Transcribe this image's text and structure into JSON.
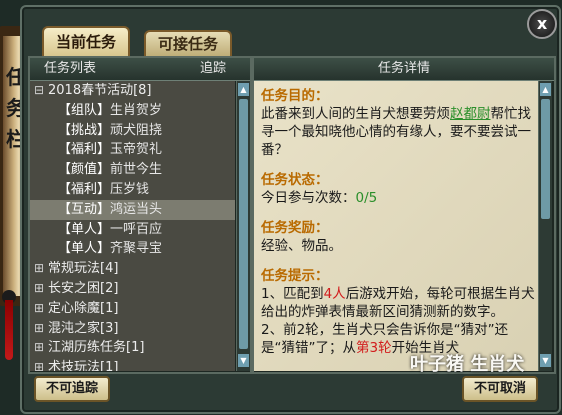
{
  "side_title": [
    "任",
    "务",
    "栏"
  ],
  "close_label": "x",
  "tabs": {
    "current": "当前任务",
    "available": "可接任务"
  },
  "left_panel": {
    "header_left": "任务列表",
    "header_right": "追踪"
  },
  "right_panel": {
    "header": "任务详情"
  },
  "quest_list": [
    {
      "type": "group",
      "expander": "⊟",
      "label": "2018春节活动[8]"
    },
    {
      "type": "item",
      "tag": "【组队】",
      "title": "生肖贺岁"
    },
    {
      "type": "item",
      "tag": "【挑战】",
      "title": "顽犬阻挠"
    },
    {
      "type": "item",
      "tag": "【福利】",
      "title": "玉帝贺礼"
    },
    {
      "type": "item",
      "tag": "【颜值】",
      "title": "前世今生"
    },
    {
      "type": "item",
      "tag": "【福利】",
      "title": "压岁钱"
    },
    {
      "type": "item",
      "tag": "【互动】",
      "title": "鸿运当头",
      "selected": true
    },
    {
      "type": "item",
      "tag": "【单人】",
      "title": "一呼百应"
    },
    {
      "type": "item",
      "tag": "【单人】",
      "title": "齐聚寻宝"
    },
    {
      "type": "group",
      "expander": "⊞",
      "label": "常规玩法[4]"
    },
    {
      "type": "group",
      "expander": "⊞",
      "label": "长安之困[2]"
    },
    {
      "type": "group",
      "expander": "⊞",
      "label": "定心除魔[1]"
    },
    {
      "type": "group",
      "expander": "⊞",
      "label": "混沌之家[3]"
    },
    {
      "type": "group",
      "expander": "⊞",
      "label": "江湖历练任务[1]"
    },
    {
      "type": "group",
      "expander": "⊞",
      "label": "术技玩法[1]"
    }
  ],
  "detail": {
    "goal_head": "任务目的：",
    "goal_pre": "此番来到人间的生肖犬想要劳烦",
    "goal_link": "赵都尉",
    "goal_post": "帮忙找寻一个最知晓他心情的有缘人，要不要尝试一番？",
    "status_head": "任务状态：",
    "status_label": "今日参与次数：",
    "status_value": "0/5",
    "reward_head": "任务奖励：",
    "reward_text": "经验、物品。",
    "hint_head": "任务提示：",
    "hint1_pre": "1、匹配到",
    "hint1_red": "4人",
    "hint1_post": "后游戏开始，每轮可根据生肖犬给出的炸弹表情最新区间猜测新的数字。",
    "hint2_pre": "2、前2轮，生肖犬只会告诉你是“猜对”还是“猜错”了；从",
    "hint2_red": "第3轮",
    "hint2_post": "开始生肖犬"
  },
  "buttons": {
    "untrack": "不可追踪",
    "cancel": "不可取消"
  },
  "watermark": "叶子猪 生肖犬"
}
